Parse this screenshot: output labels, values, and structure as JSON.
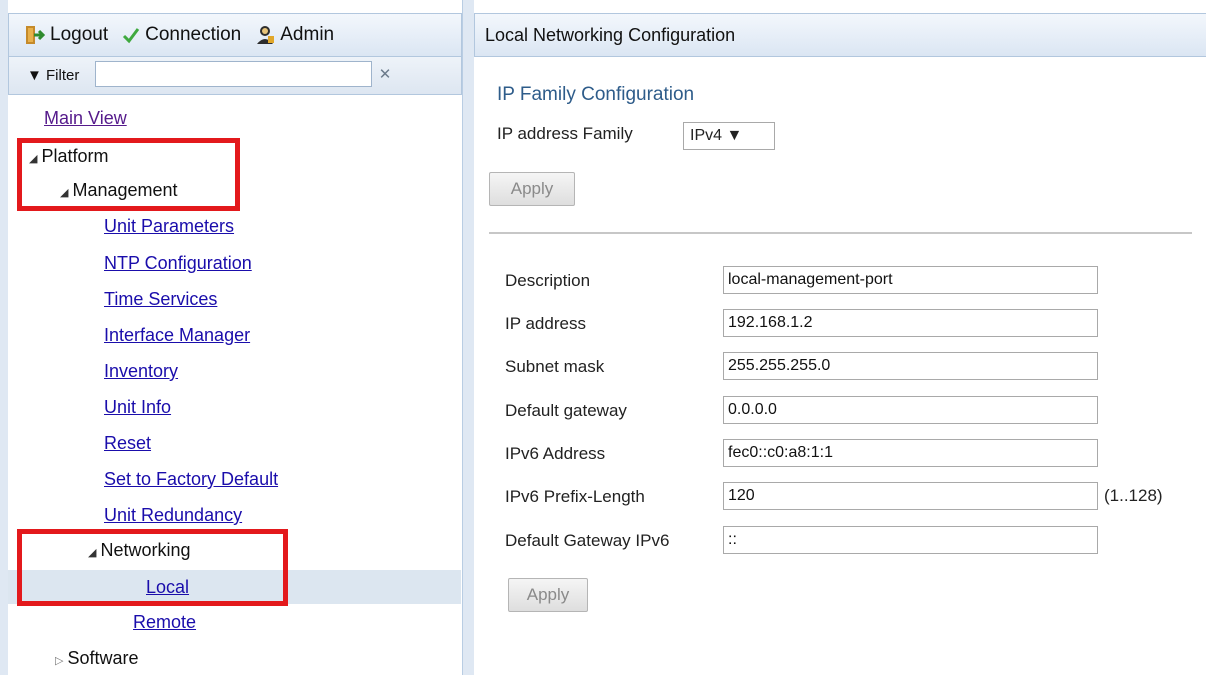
{
  "topbar": {
    "logout": "Logout",
    "connection": "Connection",
    "admin": "Admin",
    "icons": [
      "logout-icon",
      "checkmark-icon",
      "admin-user-icon"
    ]
  },
  "filter": {
    "label": "▼ Filter",
    "value": "",
    "clear_icon": "close-icon"
  },
  "tree": {
    "main_view": "Main View",
    "platform": "Platform",
    "management": "Management",
    "management_items": [
      "Unit Parameters",
      "NTP Configuration",
      "Time Services",
      "Interface Manager",
      "Inventory",
      "Unit Info",
      "Reset",
      "Set to Factory Default",
      "Unit Redundancy"
    ],
    "networking": "Networking",
    "local": "Local",
    "remote": "Remote",
    "software": "Software"
  },
  "right": {
    "header": "Local Networking Configuration",
    "section_title": "IP Family Configuration",
    "family_label": "IP address Family",
    "family_value": "IPv4 ▼",
    "apply": "Apply",
    "fields": [
      {
        "label": "Description",
        "value": "local-management-port"
      },
      {
        "label": "IP address",
        "value": "192.168.1.2"
      },
      {
        "label": "Subnet mask",
        "value": "255.255.255.0"
      },
      {
        "label": "Default gateway",
        "value": "0.0.0.0"
      },
      {
        "label": "IPv6 Address",
        "value": "fec0::c0:a8:1:1"
      },
      {
        "label": "IPv6 Prefix-Length",
        "value": "120"
      },
      {
        "label": "Default Gateway IPv6",
        "value": "::"
      }
    ],
    "prefix_range": "(1..128)"
  },
  "colors": {
    "highlight": "#e3191c",
    "link": "#1a0dab",
    "panel_header": "#dbe6f3",
    "selected_row": "#dce6f0"
  }
}
